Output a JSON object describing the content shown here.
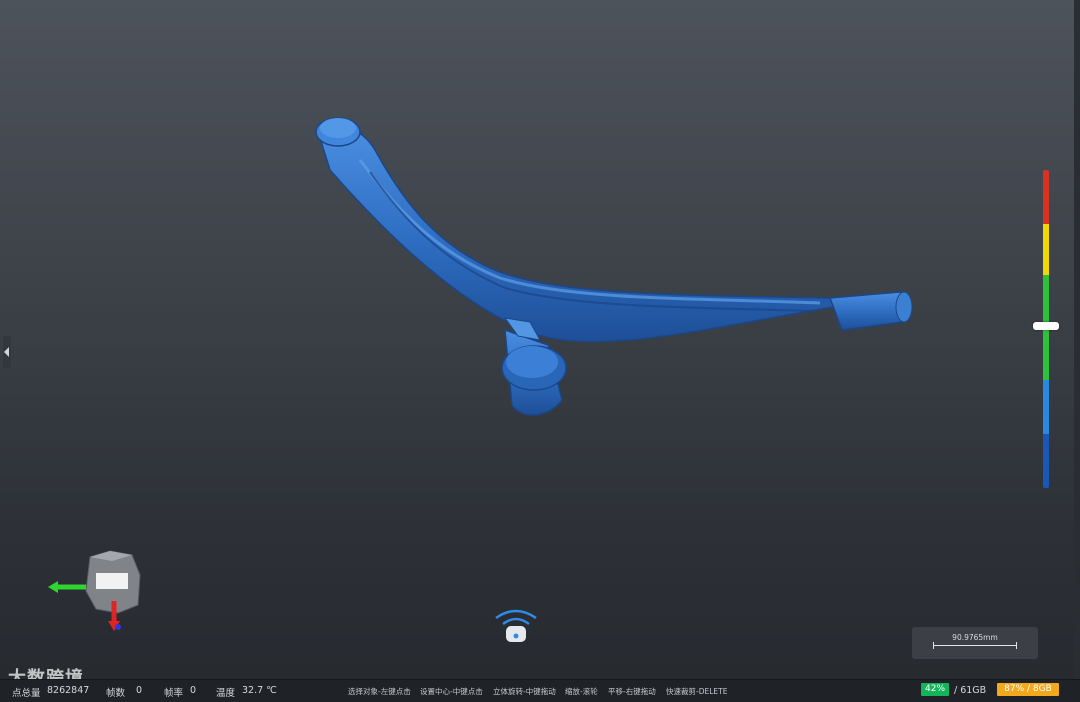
{
  "status": {
    "points_label": "点总量",
    "points_value": "8262847",
    "frames_label": "帧数",
    "frames_value": "0",
    "fps_label": "帧率",
    "fps_value": "0",
    "temp_label": "温度",
    "temp_value": "32.7 ℃",
    "hints": [
      "选择对象-左键点击",
      "设置中心-中键点击",
      "立体旋转-中键拖动",
      "缩放-滚轮",
      "平移-右键拖动",
      "快速裁剪-DELETE"
    ],
    "disk_percent": "42%",
    "disk_total": "/ 61GB",
    "mem_label": "87% / 8GB"
  },
  "scale": {
    "label": "90.9765mm"
  },
  "watermark": "大数跨境",
  "colors": {
    "model": "#2f6fc4",
    "disk_badge": "#14b45a",
    "mem_badge": "#f4a81c",
    "colorbar": [
      "#d83223",
      "#f0d800",
      "#2fc03c",
      "#2a88e0",
      "#1a58b8"
    ]
  },
  "colorbar": {
    "handle_position": 0.49
  }
}
